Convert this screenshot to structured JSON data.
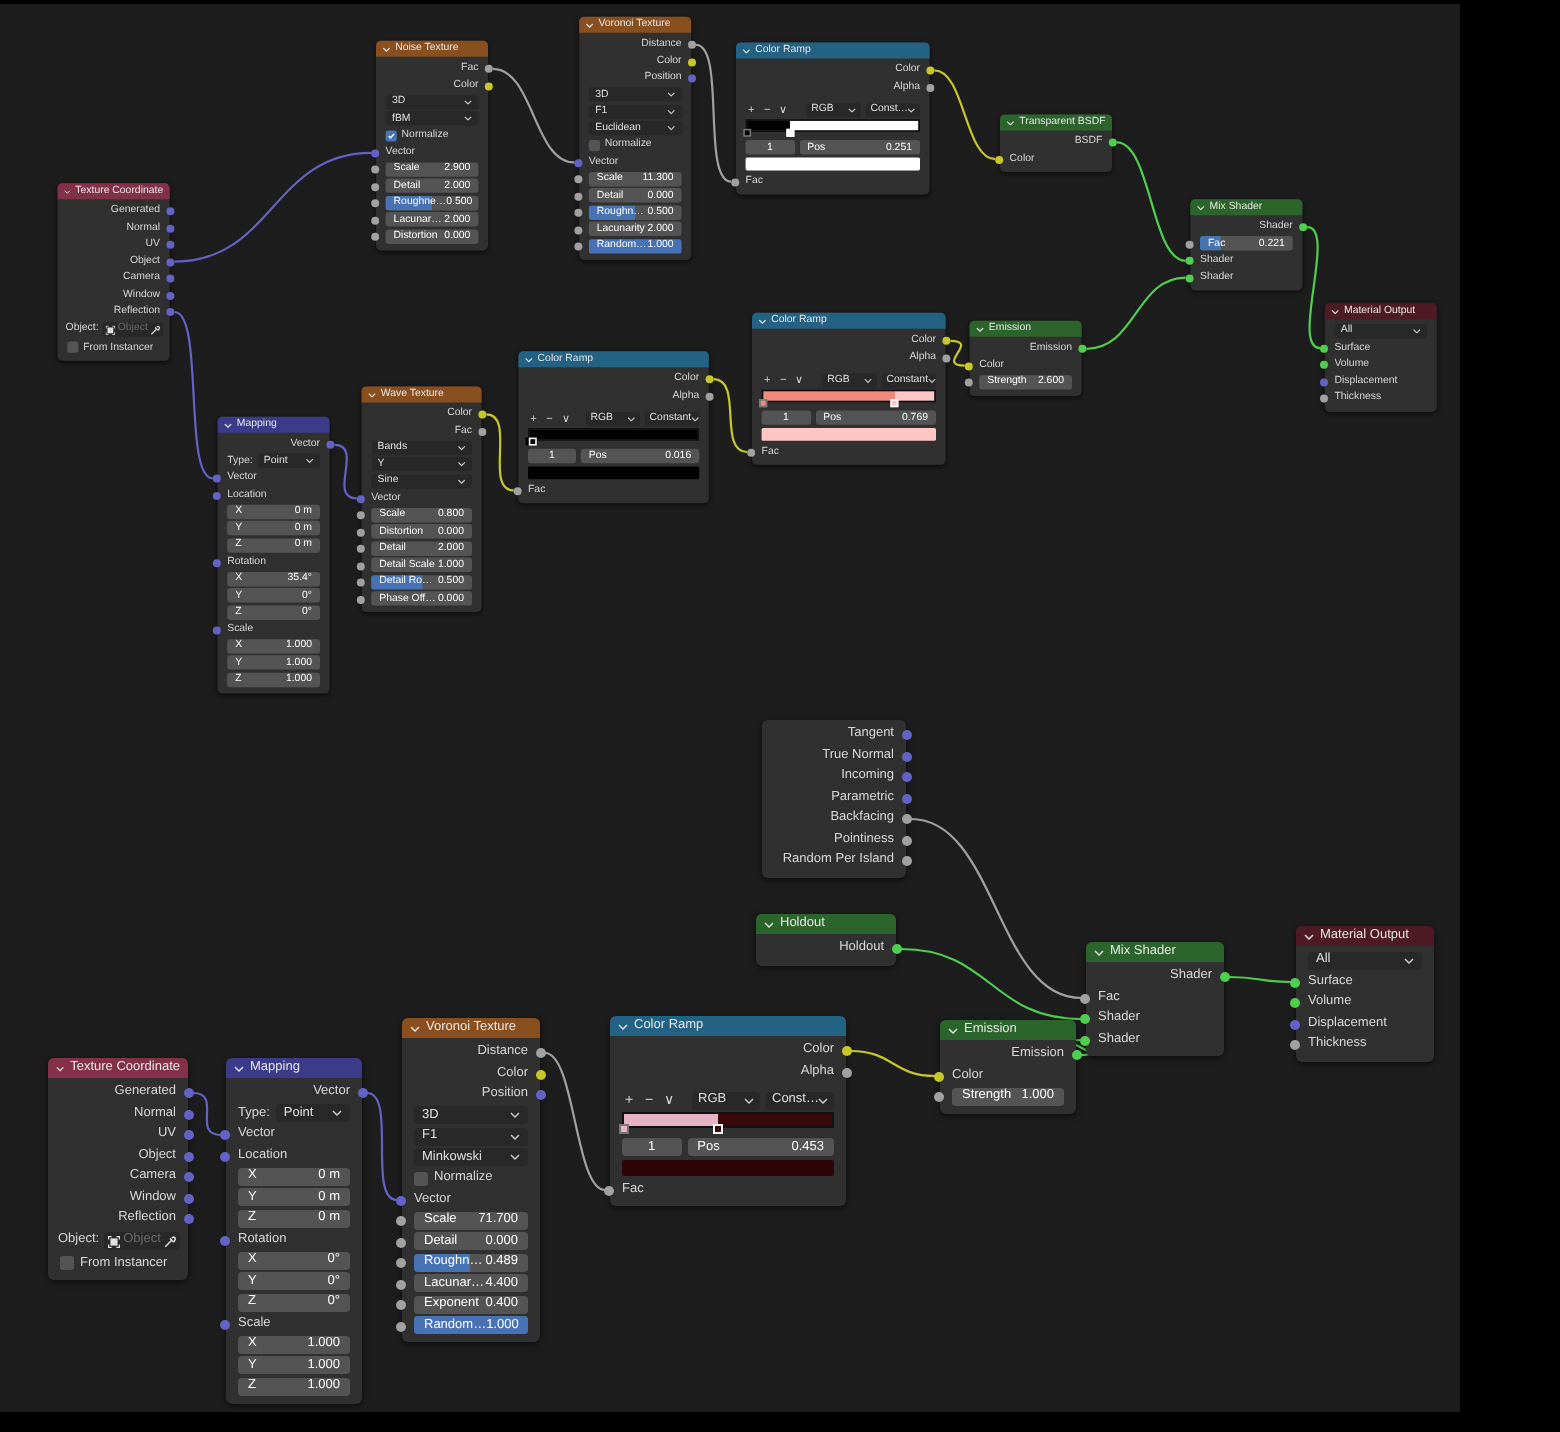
{
  "upper_nodes": [
    {
      "title": "Texture Coordinate",
      "color": "#83314a",
      "rows": [
        {
          "kind": "output",
          "label": "Generated",
          "color": "#6363c7"
        },
        {
          "kind": "output",
          "label": "Normal",
          "color": "#6363c7"
        },
        {
          "kind": "output",
          "label": "UV",
          "color": "#6363c7"
        },
        {
          "kind": "output",
          "label": "Object",
          "color": "#6363c7"
        },
        {
          "kind": "output",
          "label": "Camera",
          "color": "#6363c7"
        },
        {
          "kind": "output",
          "label": "Window",
          "color": "#6363c7"
        },
        {
          "kind": "output",
          "label": "Reflection",
          "color": "#6363c7"
        },
        {
          "kind": "object",
          "label": "Object:",
          "placeholder": "Object"
        },
        {
          "kind": "checkbox",
          "label": "From Instancer",
          "checked": false
        }
      ]
    },
    {
      "title": "Noise Texture",
      "color": "#8a4f1e",
      "rows": [
        {
          "kind": "output",
          "label": "Fac",
          "color": "#a1a1a1"
        },
        {
          "kind": "output",
          "label": "Color",
          "color": "#c7c729"
        },
        {
          "kind": "dropdown",
          "value": "3D"
        },
        {
          "kind": "dropdown",
          "value": "fBM"
        },
        {
          "kind": "checkbox",
          "label": "Normalize",
          "checked": true
        },
        {
          "kind": "input",
          "label": "Vector",
          "color": "#6363c7"
        },
        {
          "kind": "field",
          "label": "Scale",
          "value": "2.900",
          "color": "#a1a1a1"
        },
        {
          "kind": "field",
          "label": "Detail",
          "value": "2.000",
          "color": "#a1a1a1"
        },
        {
          "kind": "field",
          "label": "Roughne…",
          "value": "0.500",
          "color": "#a1a1a1",
          "level": 0.5
        },
        {
          "kind": "field",
          "label": "Lacunar…",
          "value": "2.000",
          "color": "#a1a1a1"
        },
        {
          "kind": "field",
          "label": "Distortion",
          "value": "0.000",
          "color": "#a1a1a1"
        }
      ]
    },
    {
      "title": "Voronoi Texture",
      "color": "#8a4f1e",
      "rows": [
        {
          "kind": "output",
          "label": "Distance",
          "color": "#a1a1a1"
        },
        {
          "kind": "output",
          "label": "Color",
          "color": "#c7c729"
        },
        {
          "kind": "output",
          "label": "Position",
          "color": "#6363c7"
        },
        {
          "kind": "dropdown",
          "value": "3D"
        },
        {
          "kind": "dropdown",
          "value": "F1"
        },
        {
          "kind": "dropdown",
          "value": "Euclidean"
        },
        {
          "kind": "checkbox",
          "label": "Normalize",
          "checked": false
        },
        {
          "kind": "input",
          "label": "Vector",
          "color": "#6363c7"
        },
        {
          "kind": "field",
          "label": "Scale",
          "value": "11.300",
          "color": "#a1a1a1"
        },
        {
          "kind": "field",
          "label": "Detail",
          "value": "0.000",
          "color": "#a1a1a1"
        },
        {
          "kind": "field",
          "label": "Roughn…",
          "value": "0.500",
          "color": "#a1a1a1",
          "level": 0.5
        },
        {
          "kind": "field",
          "label": "Lacunarity",
          "value": "2.000",
          "color": "#a1a1a1"
        },
        {
          "kind": "field",
          "label": "Random…",
          "value": "1.000",
          "color": "#a1a1a1",
          "level": 1
        }
      ]
    },
    {
      "title": "Color Ramp",
      "color": "#246283",
      "rows": [
        {
          "kind": "output",
          "label": "Color",
          "color": "#c7c729"
        },
        {
          "kind": "output",
          "label": "Alpha",
          "color": "#a1a1a1"
        },
        {
          "kind": "ramp_controls",
          "buttons": [
            "+",
            "−",
            "∨"
          ],
          "mode": "RGB",
          "interpolation": "Const…"
        },
        {
          "kind": "ramp",
          "stops": [
            {
              "color": "#000000",
              "level": 0,
              "selected": false
            },
            {
              "color": "#ffffff",
              "level": 0.251,
              "selected": true
            }
          ]
        },
        {
          "kind": "stop_position",
          "index": "1",
          "label": "Pos",
          "value": "0.251"
        },
        {
          "kind": "swatch",
          "color": "#ffffff"
        },
        {
          "kind": "input",
          "label": "Fac",
          "color": "#a1a1a1"
        }
      ]
    },
    {
      "title": "Transparent BSDF",
      "color": "#2b652b",
      "rows": [
        {
          "kind": "output",
          "label": "BSDF",
          "color": "#4ecf4e"
        },
        {
          "kind": "input",
          "label": "Color",
          "color": "#c7c729"
        }
      ]
    },
    {
      "title": "Mix Shader",
      "color": "#2b652b",
      "rows": [
        {
          "kind": "output",
          "label": "Shader",
          "color": "#4ecf4e"
        },
        {
          "kind": "field",
          "label": "Fac",
          "value": "0.221",
          "color": "#a1a1a1",
          "level": 0.221
        },
        {
          "kind": "input",
          "label": "Shader",
          "color": "#4ecf4e"
        },
        {
          "kind": "input",
          "label": "Shader",
          "color": "#4ecf4e"
        }
      ]
    },
    {
      "title": "Material Output",
      "color": "#4e1a24",
      "rows": [
        {
          "kind": "dropdown",
          "value": "All"
        },
        {
          "kind": "input",
          "label": "Surface",
          "color": "#4ecf4e"
        },
        {
          "kind": "input",
          "label": "Volume",
          "color": "#4ecf4e"
        },
        {
          "kind": "input",
          "label": "Displacement",
          "color": "#6363c7"
        },
        {
          "kind": "input",
          "label": "Thickness",
          "color": "#a1a1a1"
        }
      ]
    },
    {
      "title": "Mapping",
      "color": "#3b3b8a",
      "rows": [
        {
          "kind": "output",
          "label": "Vector",
          "color": "#6363c7"
        },
        {
          "kind": "type",
          "label": "Type:",
          "value": "Point"
        },
        {
          "kind": "input",
          "label": "Vector",
          "color": "#6363c7"
        },
        {
          "kind": "input",
          "label": "Location",
          "color": "#6363c7"
        },
        {
          "kind": "subfield",
          "label": "X",
          "value": "0 m"
        },
        {
          "kind": "subfield",
          "label": "Y",
          "value": "0 m"
        },
        {
          "kind": "subfield",
          "label": "Z",
          "value": "0 m"
        },
        {
          "kind": "input",
          "label": "Rotation",
          "color": "#6363c7"
        },
        {
          "kind": "subfield",
          "label": "X",
          "value": "35.4°"
        },
        {
          "kind": "subfield",
          "label": "Y",
          "value": "0°"
        },
        {
          "kind": "subfield",
          "label": "Z",
          "value": "0°"
        },
        {
          "kind": "input",
          "label": "Scale",
          "color": "#6363c7"
        },
        {
          "kind": "subfield",
          "label": "X",
          "value": "1.000"
        },
        {
          "kind": "subfield",
          "label": "Y",
          "value": "1.000"
        },
        {
          "kind": "subfield",
          "label": "Z",
          "value": "1.000"
        }
      ]
    },
    {
      "title": "Wave Texture",
      "color": "#8a4f1e",
      "rows": [
        {
          "kind": "output",
          "label": "Color",
          "color": "#c7c729"
        },
        {
          "kind": "output",
          "label": "Fac",
          "color": "#a1a1a1"
        },
        {
          "kind": "dropdown",
          "value": "Bands"
        },
        {
          "kind": "dropdown",
          "value": "Y"
        },
        {
          "kind": "dropdown",
          "value": "Sine"
        },
        {
          "kind": "input",
          "label": "Vector",
          "color": "#6363c7"
        },
        {
          "kind": "field",
          "label": "Scale",
          "value": "0.800",
          "color": "#a1a1a1"
        },
        {
          "kind": "field",
          "label": "Distortion",
          "value": "0.000",
          "color": "#a1a1a1"
        },
        {
          "kind": "field",
          "label": "Detail",
          "value": "2.000",
          "color": "#a1a1a1"
        },
        {
          "kind": "field",
          "label": "Detail Scale",
          "value": "1.000",
          "color": "#a1a1a1"
        },
        {
          "kind": "field",
          "label": "Detail Ro…",
          "value": "0.500",
          "color": "#a1a1a1",
          "level": 0.5
        },
        {
          "kind": "field",
          "label": "Phase Off…",
          "value": "0.000",
          "color": "#a1a1a1"
        }
      ]
    },
    {
      "title": "Color Ramp",
      "color": "#246283",
      "rows": [
        {
          "kind": "output",
          "label": "Color",
          "color": "#c7c729"
        },
        {
          "kind": "output",
          "label": "Alpha",
          "color": "#a1a1a1"
        },
        {
          "kind": "ramp_controls",
          "buttons": [
            "+",
            "−",
            "∨"
          ],
          "mode": "RGB",
          "interpolation": "Constant"
        },
        {
          "kind": "ramp",
          "stops": [
            {
              "color": "#000000",
              "level": 0,
              "selected": false
            },
            {
              "color": "#000000",
              "level": 0.016,
              "selected": true
            }
          ]
        },
        {
          "kind": "stop_position",
          "index": "1",
          "label": "Pos",
          "value": "0.016"
        },
        {
          "kind": "swatch",
          "color": "#000000"
        },
        {
          "kind": "input",
          "label": "Fac",
          "color": "#a1a1a1"
        }
      ]
    },
    {
      "title": "Color Ramp",
      "color": "#246283",
      "rows": [
        {
          "kind": "output",
          "label": "Color",
          "color": "#c7c729"
        },
        {
          "kind": "output",
          "label": "Alpha",
          "color": "#a1a1a1"
        },
        {
          "kind": "ramp_controls",
          "buttons": [
            "+",
            "−",
            "∨"
          ],
          "mode": "RGB",
          "interpolation": "Constant"
        },
        {
          "kind": "ramp",
          "stops": [
            {
              "color": "#f28a7c",
              "level": 0,
              "selected": false
            },
            {
              "color": "#ffc6c4",
              "level": 0.769,
              "selected": true
            }
          ]
        },
        {
          "kind": "stop_position",
          "index": "1",
          "label": "Pos",
          "value": "0.769"
        },
        {
          "kind": "swatch",
          "color": "#ffc6c4"
        },
        {
          "kind": "input",
          "label": "Fac",
          "color": "#a1a1a1"
        }
      ]
    },
    {
      "title": "Emission",
      "color": "#2b652b",
      "rows": [
        {
          "kind": "output",
          "label": "Emission",
          "color": "#4ecf4e"
        },
        {
          "kind": "input",
          "label": "Color",
          "color": "#c7c729"
        },
        {
          "kind": "field",
          "label": "Strength",
          "value": "2.600",
          "color": "#a1a1a1"
        }
      ]
    }
  ],
  "lower_nodes": [
    {
      "rows": [
        {
          "kind": "output",
          "label": "Tangent",
          "color": "#6363c7"
        },
        {
          "kind": "output",
          "label": "True Normal",
          "color": "#6363c7"
        },
        {
          "kind": "output",
          "label": "Incoming",
          "color": "#6363c7"
        },
        {
          "kind": "output",
          "label": "Parametric",
          "color": "#6363c7"
        },
        {
          "kind": "output",
          "label": "Backfacing",
          "color": "#a1a1a1"
        },
        {
          "kind": "output",
          "label": "Pointiness",
          "color": "#a1a1a1"
        },
        {
          "kind": "output",
          "label": "Random Per Island",
          "color": "#a1a1a1"
        }
      ]
    },
    {
      "title": "Holdout",
      "color": "#2b652b",
      "rows": [
        {
          "kind": "output",
          "label": "Holdout",
          "color": "#4ecf4e"
        }
      ]
    },
    {
      "title": "Mix Shader",
      "color": "#2b652b",
      "rows": [
        {
          "kind": "output",
          "label": "Shader",
          "color": "#4ecf4e"
        },
        {
          "kind": "input",
          "label": "Fac",
          "color": "#a1a1a1"
        },
        {
          "kind": "input",
          "label": "Shader",
          "color": "#4ecf4e"
        },
        {
          "kind": "input",
          "label": "Shader",
          "color": "#4ecf4e"
        }
      ]
    },
    {
      "title": "Material Output",
      "color": "#4e1a24",
      "rows": [
        {
          "kind": "dropdown",
          "value": "All"
        },
        {
          "kind": "input",
          "label": "Surface",
          "color": "#4ecf4e"
        },
        {
          "kind": "input",
          "label": "Volume",
          "color": "#4ecf4e"
        },
        {
          "kind": "input",
          "label": "Displacement",
          "color": "#6363c7"
        },
        {
          "kind": "input",
          "label": "Thickness",
          "color": "#a1a1a1"
        }
      ]
    },
    {
      "title": "Texture Coordinate",
      "color": "#83314a",
      "rows": [
        {
          "kind": "output",
          "label": "Generated",
          "color": "#6363c7"
        },
        {
          "kind": "output",
          "label": "Normal",
          "color": "#6363c7"
        },
        {
          "kind": "output",
          "label": "UV",
          "color": "#6363c7"
        },
        {
          "kind": "output",
          "label": "Object",
          "color": "#6363c7"
        },
        {
          "kind": "output",
          "label": "Camera",
          "color": "#6363c7"
        },
        {
          "kind": "output",
          "label": "Window",
          "color": "#6363c7"
        },
        {
          "kind": "output",
          "label": "Reflection",
          "color": "#6363c7"
        },
        {
          "kind": "object",
          "label": "Object:",
          "placeholder": "Object"
        },
        {
          "kind": "checkbox",
          "label": "From Instancer",
          "checked": false
        }
      ]
    },
    {
      "title": "Mapping",
      "color": "#3b3b8a",
      "rows": [
        {
          "kind": "output",
          "label": "Vector",
          "color": "#6363c7"
        },
        {
          "kind": "type",
          "label": "Type:",
          "value": "Point"
        },
        {
          "kind": "input",
          "label": "Vector",
          "color": "#6363c7"
        },
        {
          "kind": "input",
          "label": "Location",
          "color": "#6363c7"
        },
        {
          "kind": "subfield",
          "label": "X",
          "value": "0 m"
        },
        {
          "kind": "subfield",
          "label": "Y",
          "value": "0 m"
        },
        {
          "kind": "subfield",
          "label": "Z",
          "value": "0 m"
        },
        {
          "kind": "input",
          "label": "Rotation",
          "color": "#6363c7"
        },
        {
          "kind": "subfield",
          "label": "X",
          "value": "0°"
        },
        {
          "kind": "subfield",
          "label": "Y",
          "value": "0°"
        },
        {
          "kind": "subfield",
          "label": "Z",
          "value": "0°"
        },
        {
          "kind": "input",
          "label": "Scale",
          "color": "#6363c7"
        },
        {
          "kind": "subfield",
          "label": "X",
          "value": "1.000"
        },
        {
          "kind": "subfield",
          "label": "Y",
          "value": "1.000"
        },
        {
          "kind": "subfield",
          "label": "Z",
          "value": "1.000"
        }
      ]
    },
    {
      "title": "Voronoi Texture",
      "color": "#8a4f1e",
      "rows": [
        {
          "kind": "output",
          "label": "Distance",
          "color": "#a1a1a1"
        },
        {
          "kind": "output",
          "label": "Color",
          "color": "#c7c729"
        },
        {
          "kind": "output",
          "label": "Position",
          "color": "#6363c7"
        },
        {
          "kind": "dropdown",
          "value": "3D"
        },
        {
          "kind": "dropdown",
          "value": "F1"
        },
        {
          "kind": "dropdown",
          "value": "Minkowski"
        },
        {
          "kind": "checkbox",
          "label": "Normalize",
          "checked": false
        },
        {
          "kind": "input",
          "label": "Vector",
          "color": "#6363c7"
        },
        {
          "kind": "field",
          "label": "Scale",
          "value": "71.700",
          "color": "#a1a1a1"
        },
        {
          "kind": "field",
          "label": "Detail",
          "value": "0.000",
          "color": "#a1a1a1"
        },
        {
          "kind": "field",
          "label": "Roughn…",
          "value": "0.489",
          "color": "#a1a1a1",
          "level": 0.489
        },
        {
          "kind": "field",
          "label": "Lacunar…",
          "value": "4.400",
          "color": "#a1a1a1"
        },
        {
          "kind": "field",
          "label": "Exponent",
          "value": "0.400",
          "color": "#a1a1a1"
        },
        {
          "kind": "field",
          "label": "Random…",
          "value": "1.000",
          "color": "#a1a1a1",
          "level": 1
        }
      ]
    },
    {
      "title": "Color Ramp",
      "color": "#246283",
      "rows": [
        {
          "kind": "output",
          "label": "Color",
          "color": "#c7c729"
        },
        {
          "kind": "output",
          "label": "Alpha",
          "color": "#a1a1a1"
        },
        {
          "kind": "ramp_controls",
          "buttons": [
            "+",
            "−",
            "∨"
          ],
          "mode": "RGB",
          "interpolation": "Const…"
        },
        {
          "kind": "ramp",
          "stops": [
            {
              "color": "#e6b4c4",
              "level": 0,
              "selected": false
            },
            {
              "color": "#3a0808",
              "level": 0.453,
              "selected": true
            }
          ]
        },
        {
          "kind": "stop_position",
          "index": "1",
          "label": "Pos",
          "value": "0.453"
        },
        {
          "kind": "swatch",
          "color": "#2e0505"
        },
        {
          "kind": "input",
          "label": "Fac",
          "color": "#a1a1a1"
        }
      ]
    },
    {
      "title": "Emission",
      "color": "#2b652b",
      "rows": [
        {
          "kind": "output",
          "label": "Emission",
          "color": "#4ecf4e"
        },
        {
          "kind": "input",
          "label": "Color",
          "color": "#c7c729"
        },
        {
          "kind": "field",
          "label": "Strength",
          "value": "1.000",
          "color": "#a1a1a1"
        }
      ]
    }
  ]
}
